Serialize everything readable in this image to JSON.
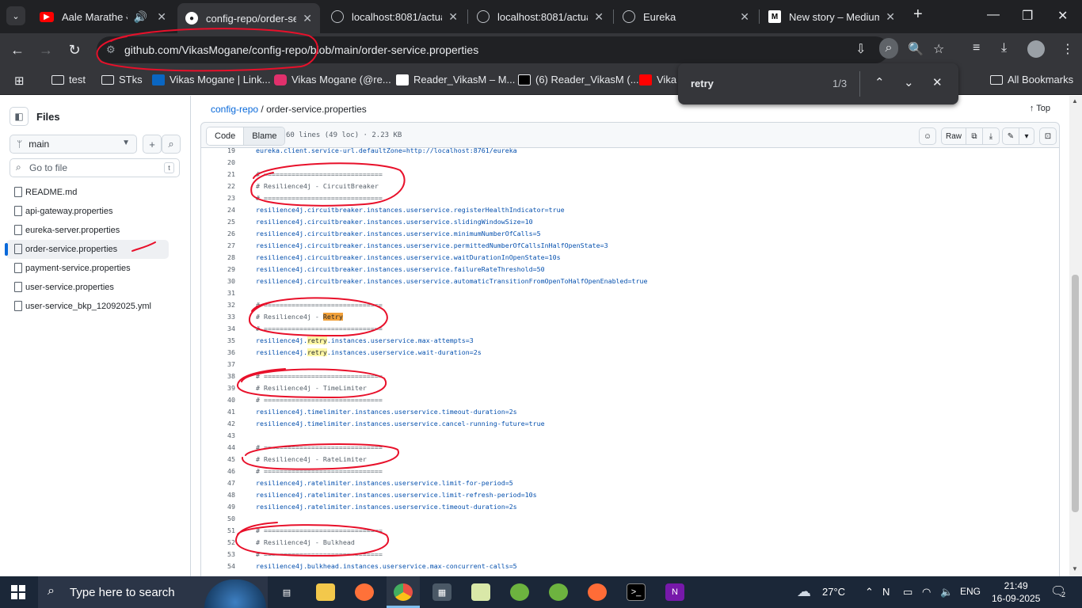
{
  "browser": {
    "tabs": [
      {
        "title": "Aale Marathe आले",
        "icon": "youtube-icon"
      },
      {
        "title": "config-repo/order-se",
        "icon": "github-icon"
      },
      {
        "title": "localhost:8081/actuat",
        "icon": "globe-icon"
      },
      {
        "title": "localhost:8081/actuat",
        "icon": "globe-icon"
      },
      {
        "title": "Eureka",
        "icon": "globe-icon"
      },
      {
        "title": "New story – Medium",
        "icon": "medium-icon"
      }
    ],
    "url": "github.com/VikasMogane/config-repo/blob/main/order-service.properties",
    "bookmarks": [
      {
        "label": "test",
        "icon": "folder-icon"
      },
      {
        "label": "STks",
        "icon": "folder-icon"
      },
      {
        "label": "Vikas Mogane | Link...",
        "icon": "linkedin-icon"
      },
      {
        "label": "Vikas Mogane (@re...",
        "icon": "instagram-icon"
      },
      {
        "label": "Reader_VikasM – M...",
        "icon": "medium-icon"
      },
      {
        "label": "(6) Reader_VikasM (...",
        "icon": "x-icon"
      },
      {
        "label": "Vika",
        "icon": "youtube-icon"
      }
    ],
    "all_bookmarks": "All Bookmarks",
    "find": {
      "query": "retry",
      "count": "1/3"
    }
  },
  "sidebar": {
    "title": "Files",
    "branch": "main",
    "goto_placeholder": "Go to file",
    "goto_kbd": "t",
    "files": [
      {
        "name": "README.md",
        "active": false
      },
      {
        "name": "api-gateway.properties",
        "active": false
      },
      {
        "name": "eureka-server.properties",
        "active": false
      },
      {
        "name": "order-service.properties",
        "active": true
      },
      {
        "name": "payment-service.properties",
        "active": false
      },
      {
        "name": "user-service.properties",
        "active": false
      },
      {
        "name": "user-service_bkp_12092025.yml",
        "active": false
      }
    ]
  },
  "main": {
    "breadcrumb_repo": "config-repo",
    "breadcrumb_sep": " / ",
    "breadcrumb_file": "order-service.properties",
    "top_label": "Top",
    "code_tab": "Code",
    "blame_tab": "Blame",
    "meta": "60 lines (49 loc) · 2.23 KB",
    "raw_label": "Raw",
    "lines": [
      {
        "n": "19",
        "t": "eureka.client.service-url.defaultZone=http://localhost:8761/eureka"
      },
      {
        "n": "20",
        "t": ""
      },
      {
        "n": "21",
        "t": "# =============================="
      },
      {
        "n": "22",
        "t": "# Resilience4j - CircuitBreaker"
      },
      {
        "n": "23",
        "t": "# =============================="
      },
      {
        "n": "24",
        "t": "resilience4j.circuitbreaker.instances.userservice.registerHealthIndicator=true"
      },
      {
        "n": "25",
        "t": "resilience4j.circuitbreaker.instances.userservice.slidingWindowSize=10"
      },
      {
        "n": "26",
        "t": "resilience4j.circuitbreaker.instances.userservice.minimumNumberOfCalls=5"
      },
      {
        "n": "27",
        "t": "resilience4j.circuitbreaker.instances.userservice.permittedNumberOfCallsInHalfOpenState=3"
      },
      {
        "n": "28",
        "t": "resilience4j.circuitbreaker.instances.userservice.waitDurationInOpenState=10s"
      },
      {
        "n": "29",
        "t": "resilience4j.circuitbreaker.instances.userservice.failureRateThreshold=50"
      },
      {
        "n": "30",
        "t": "resilience4j.circuitbreaker.instances.userservice.automaticTransitionFromOpenToHalfOpenEnabled=true"
      },
      {
        "n": "31",
        "t": ""
      },
      {
        "n": "32",
        "t": "# =============================="
      },
      {
        "n": "33",
        "t": "# Resilience4j - Retry",
        "hl": "current"
      },
      {
        "n": "34",
        "t": "# =============================="
      },
      {
        "n": "35",
        "t": "resilience4j.retry.instances.userservice.max-attempts=3",
        "hl": "match"
      },
      {
        "n": "36",
        "t": "resilience4j.retry.instances.userservice.wait-duration=2s",
        "hl": "match"
      },
      {
        "n": "37",
        "t": ""
      },
      {
        "n": "38",
        "t": "# =============================="
      },
      {
        "n": "39",
        "t": "# Resilience4j - TimeLimiter"
      },
      {
        "n": "40",
        "t": "# =============================="
      },
      {
        "n": "41",
        "t": "resilience4j.timelimiter.instances.userservice.timeout-duration=2s"
      },
      {
        "n": "42",
        "t": "resilience4j.timelimiter.instances.userservice.cancel-running-future=true"
      },
      {
        "n": "43",
        "t": ""
      },
      {
        "n": "44",
        "t": "# =============================="
      },
      {
        "n": "45",
        "t": "# Resilience4j - RateLimiter"
      },
      {
        "n": "46",
        "t": "# =============================="
      },
      {
        "n": "47",
        "t": "resilience4j.ratelimiter.instances.userservice.limit-for-period=5"
      },
      {
        "n": "48",
        "t": "resilience4j.ratelimiter.instances.userservice.limit-refresh-period=10s"
      },
      {
        "n": "49",
        "t": "resilience4j.ratelimiter.instances.userservice.timeout-duration=2s"
      },
      {
        "n": "50",
        "t": ""
      },
      {
        "n": "51",
        "t": "# =============================="
      },
      {
        "n": "52",
        "t": "# Resilience4j - Bulkhead"
      },
      {
        "n": "53",
        "t": "# =============================="
      },
      {
        "n": "54",
        "t": "resilience4j.bulkhead.instances.userservice.max-concurrent-calls=5"
      }
    ]
  },
  "taskbar": {
    "search_placeholder": "Type here to search",
    "weather": "27°C",
    "lang": "ENG",
    "time": "21:49",
    "date": "16-09-2025",
    "notifications": "2"
  },
  "colors": {
    "link": "#0969da",
    "annotation": "#e8102a",
    "match": "#fff8a5",
    "current_match": "#f2a13a"
  }
}
